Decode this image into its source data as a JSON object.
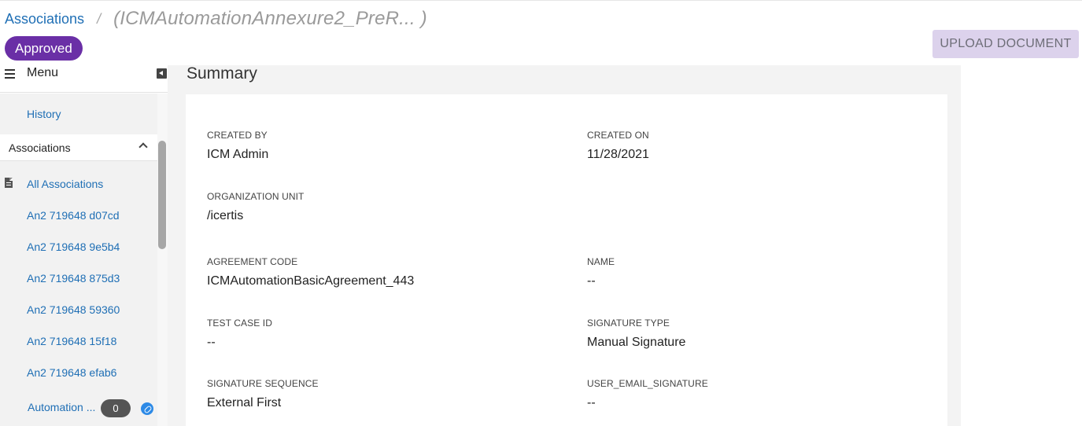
{
  "breadcrumb": {
    "parent": "Associations",
    "separator": "/",
    "current": "(ICMAutomationAnnexure2_PreR... )"
  },
  "status": {
    "label": "Approved",
    "color": "#6a2fa6"
  },
  "actions": {
    "upload_label": "UPLOAD DOCUMENT"
  },
  "sidebar": {
    "menu_label": "Menu",
    "history_label": "History",
    "section_label": "Associations",
    "items": [
      {
        "label": "All Associations",
        "icon": "document-icon"
      },
      {
        "label": "An2 719648 d07cd"
      },
      {
        "label": "An2 719648 9e5b4"
      },
      {
        "label": "An2 719648 875d3"
      },
      {
        "label": "An2 719648 59360"
      },
      {
        "label": "An2 719648 15f18"
      },
      {
        "label": "An2 719648 efab6"
      },
      {
        "label": "Automation ...",
        "count": "0",
        "icon": "link-icon"
      }
    ]
  },
  "summary": {
    "title": "Summary",
    "fields": {
      "created_by": {
        "label": "CREATED BY",
        "value": "ICM Admin"
      },
      "created_on": {
        "label": "CREATED ON",
        "value": "11/28/2021"
      },
      "organization_unit": {
        "label": "ORGANIZATION UNIT",
        "value": "/icertis"
      },
      "agreement_code": {
        "label": "AGREEMENT CODE",
        "value": "ICMAutomationBasicAgreement_443"
      },
      "name": {
        "label": "NAME",
        "value": "--"
      },
      "test_case_id": {
        "label": "TEST CASE ID",
        "value": "--"
      },
      "signature_type": {
        "label": "SIGNATURE TYPE",
        "value": "Manual Signature"
      },
      "signature_sequence": {
        "label": "SIGNATURE SEQUENCE",
        "value": "External First"
      },
      "user_email_signature": {
        "label": "USER_EMAIL_SIGNATURE",
        "value": "--"
      }
    }
  },
  "colors": {
    "link": "#1f6fb5",
    "accent": "#6a2fa6",
    "button_bg": "#dcd2ec"
  }
}
